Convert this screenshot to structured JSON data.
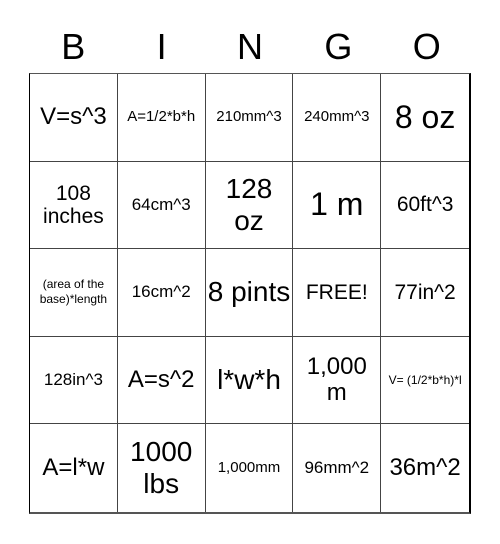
{
  "header": {
    "letters": [
      "B",
      "I",
      "N",
      "G",
      "O"
    ]
  },
  "cells": [
    {
      "text": "V=s^3",
      "size": "s-m"
    },
    {
      "text": "A=1/2*b*h",
      "size": "s-xs"
    },
    {
      "text": "210mm^3",
      "size": "s-xs"
    },
    {
      "text": "240mm^3",
      "size": "s-xs"
    },
    {
      "text": "8 oz",
      "size": "s-xl"
    },
    {
      "text": "108 inches",
      "size": "s-ms"
    },
    {
      "text": "64cm^3",
      "size": "s-s"
    },
    {
      "text": "128 oz",
      "size": "s-l"
    },
    {
      "text": "1 m",
      "size": "s-xl"
    },
    {
      "text": "60ft^3",
      "size": "s-ms"
    },
    {
      "text": "(area of the base)*length",
      "size": "s-xxs"
    },
    {
      "text": "16cm^2",
      "size": "s-s"
    },
    {
      "text": "8 pints",
      "size": "s-l"
    },
    {
      "text": "FREE!",
      "size": "s-ms"
    },
    {
      "text": "77in^2",
      "size": "s-ms"
    },
    {
      "text": "128in^3",
      "size": "s-s"
    },
    {
      "text": "A=s^2",
      "size": "s-m"
    },
    {
      "text": "l*w*h",
      "size": "s-l"
    },
    {
      "text": "1,000 m",
      "size": "s-m"
    },
    {
      "text": "V= (1/2*b*h)*l",
      "size": "s-xxs"
    },
    {
      "text": "A=l*w",
      "size": "s-m"
    },
    {
      "text": "1000 lbs",
      "size": "s-l"
    },
    {
      "text": "1,000mm",
      "size": "s-xs"
    },
    {
      "text": "96mm^2",
      "size": "s-s"
    },
    {
      "text": "36m^2",
      "size": "s-m"
    }
  ]
}
